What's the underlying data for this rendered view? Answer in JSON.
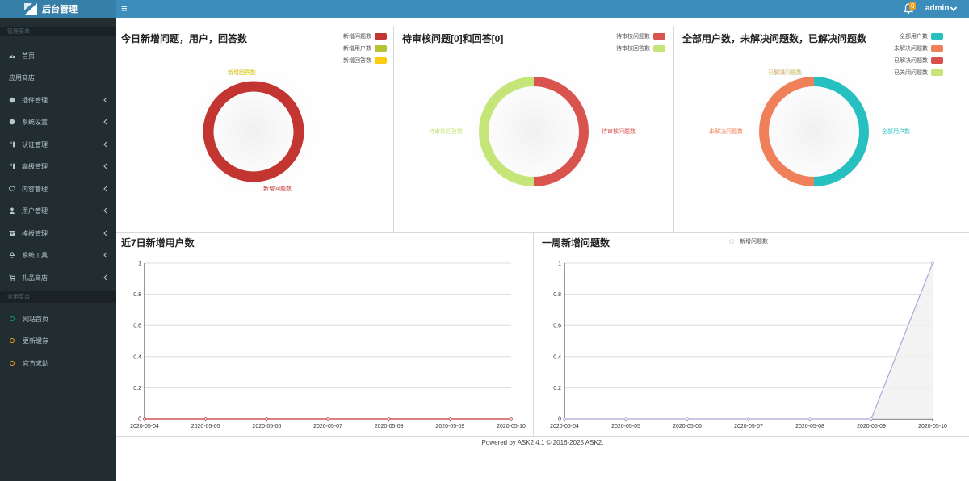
{
  "header": {
    "brand": "后台管理",
    "menu_toggle_icon": "hamburger-menu-icon",
    "notification_count": "0",
    "user_name": "admin"
  },
  "sidebar": {
    "section_main": "管理菜单",
    "items": [
      {
        "label": "首页",
        "icon": "dashboard-icon",
        "submenu": false
      },
      {
        "label": "应用商店",
        "icon": "",
        "submenu": false
      },
      {
        "label": "插件管理",
        "icon": "circle-icon",
        "submenu": true
      },
      {
        "label": "系统设置",
        "icon": "circle-icon",
        "submenu": true
      },
      {
        "label": "认证管理",
        "icon": "cutlery-icon",
        "submenu": true
      },
      {
        "label": "高级管理",
        "icon": "cutlery-icon",
        "submenu": true
      },
      {
        "label": "内容管理",
        "icon": "comments-icon",
        "submenu": true
      },
      {
        "label": "用户管理",
        "icon": "user-icon",
        "submenu": true
      },
      {
        "label": "模板管理",
        "icon": "archive-icon",
        "submenu": true
      },
      {
        "label": "系统工具",
        "icon": "recycle-icon",
        "submenu": true
      },
      {
        "label": "礼品商店",
        "icon": "cart-icon",
        "submenu": true
      }
    ],
    "section_common": "常用菜单",
    "common_items": [
      {
        "label": "网站首页",
        "color": "#00a65a"
      },
      {
        "label": "更新缓存",
        "color": "#f39c12"
      },
      {
        "label": "官方求助",
        "color": "#f39c12"
      }
    ]
  },
  "panels": {
    "today": {
      "title": "今日新增问题，用户，回答数"
    },
    "pending": {
      "title": "待审核问题[0]和回答[0]"
    },
    "totals": {
      "title": "全部用户数，未解决问题数，已解决问题数"
    },
    "users7": {
      "title": "近7日新增用户数"
    },
    "questions7": {
      "title": "一周新增问题数"
    }
  },
  "footer": {
    "text": "Powered by ASK2 4.1 © 2016-2025 ASK2."
  },
  "chart_data": [
    {
      "type": "pie",
      "subtype": "donut",
      "title": "今日新增问题，用户，回答数",
      "legend_position": "top-right",
      "series": [
        {
          "name": "新增问题数",
          "value": 1,
          "color": "#c23531"
        },
        {
          "name": "新增用户数",
          "value": 0,
          "color": "#b5c334"
        },
        {
          "name": "新增回答数",
          "value": 0,
          "color": "#fcce10"
        }
      ]
    },
    {
      "type": "pie",
      "subtype": "donut",
      "title": "待审核问题[0]和回答[0]",
      "legend_position": "top-right",
      "series": [
        {
          "name": "待审核问题数",
          "value": 0,
          "color": "#d9534f"
        },
        {
          "name": "待审核回答数",
          "value": 0,
          "color": "#c6e579"
        }
      ]
    },
    {
      "type": "pie",
      "subtype": "donut",
      "title": "全部用户数，未解决问题数，已解决问题数",
      "legend_position": "top-right",
      "series": [
        {
          "name": "全部用户数",
          "value": 1,
          "color": "#26c0c0"
        },
        {
          "name": "未解决问题数",
          "value": 1,
          "color": "#f0805a"
        },
        {
          "name": "已解决问题数",
          "value": 0,
          "color": "#d7504b"
        },
        {
          "name": "已关闭问题数",
          "value": 0,
          "color": "#c6e579"
        }
      ]
    },
    {
      "type": "line",
      "title": "近7日新增用户数",
      "x": [
        "2020-05-04",
        "2020-05-05",
        "2020-05-06",
        "2020-05-07",
        "2020-05-08",
        "2020-05-09",
        "2020-05-10"
      ],
      "series": [
        {
          "values": [
            0,
            0,
            0,
            0,
            0,
            0,
            0
          ],
          "color": "#c23531"
        }
      ],
      "ylim": [
        0,
        1
      ],
      "yticks": [
        "0",
        "0.2",
        "0.4",
        "0.6",
        "0.8",
        "1"
      ],
      "grid": true
    },
    {
      "type": "area",
      "title": "一周新增问题数",
      "x": [
        "2020-05-04",
        "2020-05-05",
        "2020-05-06",
        "2020-05-07",
        "2020-05-08",
        "2020-05-09",
        "2020-05-10"
      ],
      "series": [
        {
          "name": "新增问题数",
          "values": [
            0,
            0,
            0,
            0,
            0,
            0,
            1
          ],
          "color": "#b6a2de"
        }
      ],
      "ylim": [
        0,
        1
      ],
      "yticks": [
        "0",
        "0.2",
        "0.4",
        "0.6",
        "0.8",
        "1"
      ],
      "grid": true,
      "legend_position": "top"
    }
  ]
}
